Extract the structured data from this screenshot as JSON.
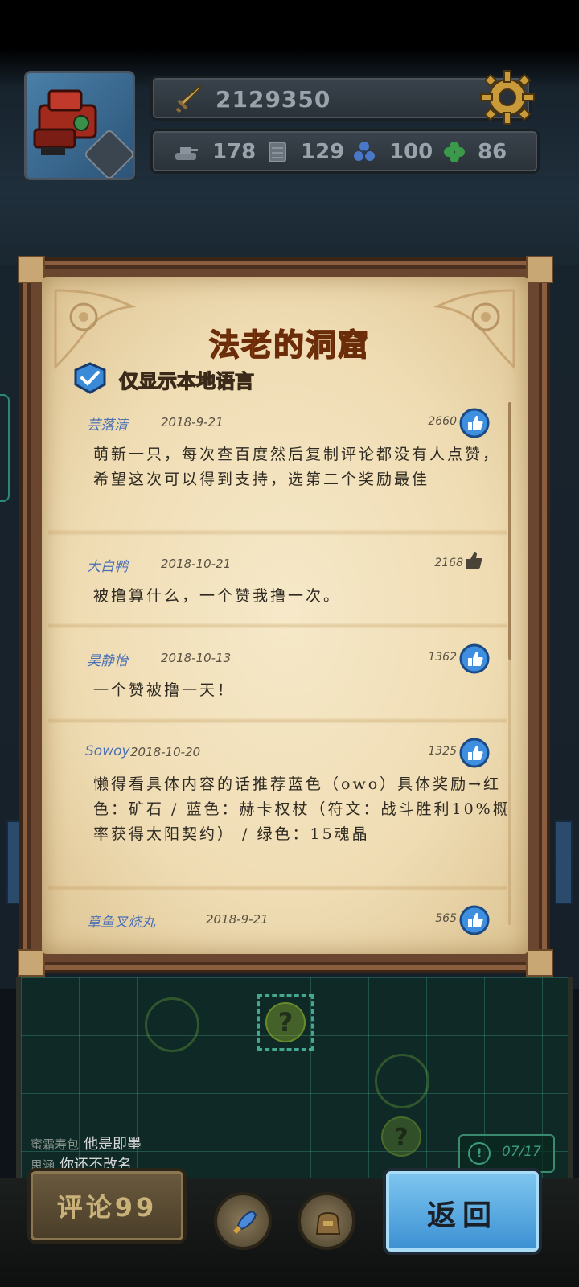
{
  "header": {
    "power": "2129350",
    "resources": [
      {
        "icon": "tank-icon",
        "value": "178"
      },
      {
        "icon": "crate-icon",
        "value": "129"
      },
      {
        "icon": "propeller-icon",
        "value": "100"
      },
      {
        "icon": "clover-icon",
        "value": "86"
      }
    ]
  },
  "panel": {
    "title": "法老的洞窟",
    "local_only_label": "仅显示本地语言",
    "comments": [
      {
        "name": "芸落清",
        "date": "2018-9-21",
        "likes": "2660",
        "liked": true,
        "body": "萌新一只，每次查百度然后复制评论都没有人点赞，希望这次可以得到支持，选第二个奖励最佳"
      },
      {
        "name": "大白鸭",
        "date": "2018-10-21",
        "likes": "2168",
        "liked": false,
        "body": "被撸算什么，一个赞我撸一次。"
      },
      {
        "name": "昊静怡",
        "date": "2018-10-13",
        "likes": "1362",
        "liked": true,
        "body": "一个赞被撸一天！"
      },
      {
        "name": "Sowoy",
        "date": "2018-10-20",
        "likes": "1325",
        "liked": true,
        "body": "懒得看具体内容的话推荐蓝色（owo）具体奖励→红色：矿石 / 蓝色：赫卡权杖（符文：战斗胜利10%概率获得太阳契约） / 绿色：15魂晶"
      },
      {
        "name": "章鱼叉烧丸",
        "date": "2018-9-21",
        "likes": "565",
        "liked": true,
        "body": ""
      }
    ]
  },
  "chat": [
    {
      "who": "蜜霜寿包",
      "text": "他是即墨"
    },
    {
      "who": "思涵",
      "text": "你还不改名"
    }
  ],
  "counter": "07/17",
  "buttons": {
    "comment": "评论99",
    "back": "返回"
  }
}
